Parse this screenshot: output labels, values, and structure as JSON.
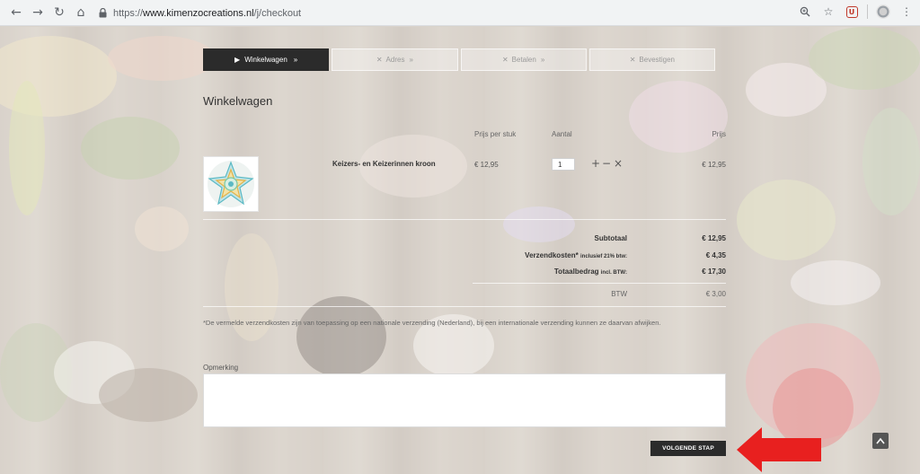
{
  "browser": {
    "url_protocol": "https://",
    "url_host": "www.kimenzocreations.nl",
    "url_path": "/j/checkout",
    "icons": [
      "back-icon",
      "forward-icon",
      "reload-icon",
      "home-icon",
      "lock-icon",
      "zoom-icon",
      "star-icon",
      "extension-icon",
      "profile-icon",
      "menu-icon"
    ]
  },
  "steps": [
    {
      "label": "Winkelwagen",
      "state": "active"
    },
    {
      "label": "Adres",
      "state": "inactive"
    },
    {
      "label": "Betalen",
      "state": "inactive"
    },
    {
      "label": "Bevestigen",
      "state": "inactive"
    }
  ],
  "cart": {
    "title": "Winkelwagen",
    "headers": {
      "unit_price": "Prijs per stuk",
      "quantity": "Aantal",
      "price": "Prijs"
    },
    "items": [
      {
        "name": "Keizers- en Keizerinnen kroon",
        "unit_price": "€ 12,95",
        "quantity": "1",
        "price": "€ 12,95"
      }
    ],
    "controls": {
      "plus": "+",
      "minus": "−",
      "remove": "×"
    }
  },
  "summary": {
    "subtotal_label": "Subtotaal",
    "subtotal_value": "€ 12,95",
    "shipping_label": "Verzendkosten*",
    "shipping_sub": "inclusief 21% btw:",
    "shipping_value": "€ 4,35",
    "total_label": "Totaalbedrag",
    "total_sub": "incl. BTW:",
    "total_value": "€ 17,30",
    "btw_label": "BTW",
    "btw_value": "€ 3,00"
  },
  "note": "*De vermelde verzendkosten zijn van toepassing op een nationale verzending (Nederland), bij een internationale verzending kunnen ze daarvan afwijken.",
  "remark_label": "Opmerking",
  "remark_value": "",
  "next_button": "VOLGENDE STAP",
  "colors": {
    "accent_dark": "#2b2b2b",
    "arrow": "#e8201f"
  }
}
